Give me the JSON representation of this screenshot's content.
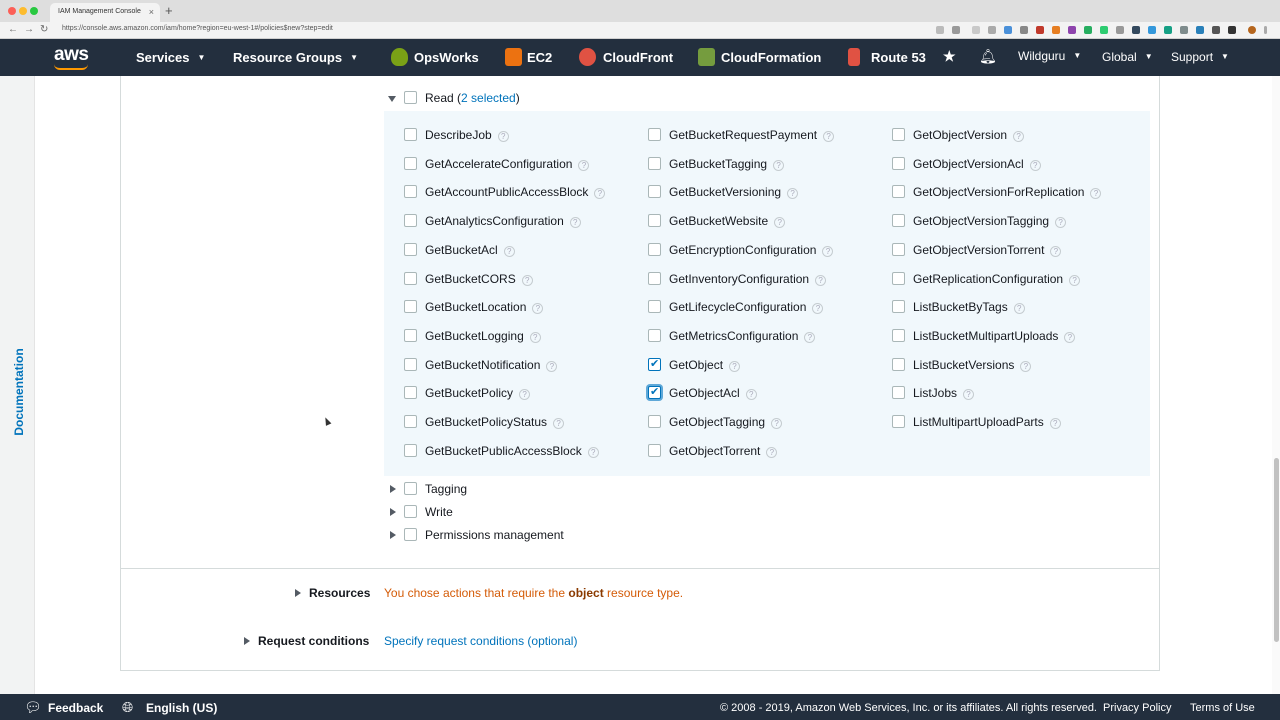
{
  "browser": {
    "tab_title": "IAM Management Console",
    "url": "https://console.aws.amazon.com/iam/home?region=eu-west-1#/policies$new?step=edit"
  },
  "header": {
    "logo": "aws",
    "nav": [
      "Services",
      "Resource Groups"
    ],
    "services": [
      "OpsWorks",
      "EC2",
      "CloudFront",
      "CloudFormation",
      "Route 53"
    ],
    "user": "Wildguru",
    "region": "Global",
    "support": "Support"
  },
  "sidebar": {
    "documentation": "Documentation"
  },
  "read_group": {
    "label": "Read",
    "selected_count": "2 selected",
    "columns": [
      [
        {
          "label": "DescribeJob",
          "checked": false
        },
        {
          "label": "GetAccelerateConfiguration",
          "checked": false
        },
        {
          "label": "GetAccountPublicAccessBlock",
          "checked": false
        },
        {
          "label": "GetAnalyticsConfiguration",
          "checked": false
        },
        {
          "label": "GetBucketAcl",
          "checked": false
        },
        {
          "label": "GetBucketCORS",
          "checked": false
        },
        {
          "label": "GetBucketLocation",
          "checked": false
        },
        {
          "label": "GetBucketLogging",
          "checked": false
        },
        {
          "label": "GetBucketNotification",
          "checked": false
        },
        {
          "label": "GetBucketPolicy",
          "checked": false
        },
        {
          "label": "GetBucketPolicyStatus",
          "checked": false
        },
        {
          "label": "GetBucketPublicAccessBlock",
          "checked": false
        }
      ],
      [
        {
          "label": "GetBucketRequestPayment",
          "checked": false
        },
        {
          "label": "GetBucketTagging",
          "checked": false
        },
        {
          "label": "GetBucketVersioning",
          "checked": false
        },
        {
          "label": "GetBucketWebsite",
          "checked": false
        },
        {
          "label": "GetEncryptionConfiguration",
          "checked": false
        },
        {
          "label": "GetInventoryConfiguration",
          "checked": false
        },
        {
          "label": "GetLifecycleConfiguration",
          "checked": false
        },
        {
          "label": "GetMetricsConfiguration",
          "checked": false
        },
        {
          "label": "GetObject",
          "checked": true
        },
        {
          "label": "GetObjectAcl",
          "checked": true
        },
        {
          "label": "GetObjectTagging",
          "checked": false
        },
        {
          "label": "GetObjectTorrent",
          "checked": false
        }
      ],
      [
        {
          "label": "GetObjectVersion",
          "checked": false
        },
        {
          "label": "GetObjectVersionAcl",
          "checked": false
        },
        {
          "label": "GetObjectVersionForReplication",
          "checked": false
        },
        {
          "label": "GetObjectVersionTagging",
          "checked": false
        },
        {
          "label": "GetObjectVersionTorrent",
          "checked": false
        },
        {
          "label": "GetReplicationConfiguration",
          "checked": false
        },
        {
          "label": "ListBucketByTags",
          "checked": false
        },
        {
          "label": "ListBucketMultipartUploads",
          "checked": false
        },
        {
          "label": "ListBucketVersions",
          "checked": false
        },
        {
          "label": "ListJobs",
          "checked": false
        },
        {
          "label": "ListMultipartUploadParts",
          "checked": false
        }
      ]
    ]
  },
  "other_groups": [
    "Tagging",
    "Write",
    "Permissions management"
  ],
  "resources": {
    "label": "Resources",
    "message_before": "You chose actions that require the",
    "message_bold": "object",
    "message_after": "resource type."
  },
  "request_conditions": {
    "label": "Request conditions",
    "link": "Specify request conditions (optional)"
  },
  "footer": {
    "feedback": "Feedback",
    "language": "English (US)",
    "copyright": "© 2008 - 2019, Amazon Web Services, Inc. or its affiliates. All rights reserved.",
    "privacy": "Privacy Policy",
    "terms": "Terms of Use"
  },
  "colors": {
    "header_bg": "#232f3e",
    "link": "#0073bb",
    "warning": "#d45b07",
    "read_box_bg": "#f1f8fc"
  }
}
